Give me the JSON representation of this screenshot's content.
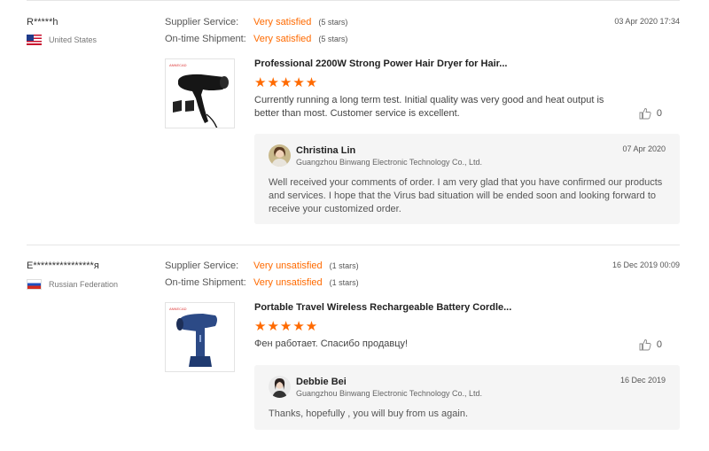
{
  "reviews": [
    {
      "buyer": "R*****h",
      "country": "United States",
      "supplier_service_label": "Supplier Service:",
      "supplier_service_value": "Very satisfied",
      "supplier_service_stars": "(5 stars)",
      "shipment_label": "On-time Shipment:",
      "shipment_value": "Very satisfied",
      "shipment_stars": "(5 stars)",
      "date": "03 Apr 2020 17:34",
      "product_brand": "ANNECAD",
      "product_title": "Professional 2200W Strong Power Hair Dryer for Hair...",
      "stars": "★★★★★",
      "rating": 5,
      "text": "Currently running a long term test. Initial quality was very good and heat output is better than most. Customer service is excellent.",
      "helpful_count": "0",
      "reply": {
        "name": "Christina Lin",
        "company": "Guangzhou Binwang Electronic Technology Co., Ltd.",
        "date": "07 Apr 2020",
        "text": "Well received your comments of order. I am very glad that you have confirmed our products and services. I hope that the Virus  bad situation will be ended soon  and  looking forward to receive your customized order."
      }
    },
    {
      "buyer": "E****************я",
      "country": "Russian Federation",
      "supplier_service_label": "Supplier Service:",
      "supplier_service_value": "Very unsatisfied",
      "supplier_service_stars": "(1 stars)",
      "shipment_label": "On-time Shipment:",
      "shipment_value": "Very unsatisfied",
      "shipment_stars": "(1 stars)",
      "date": "16 Dec 2019 00:09",
      "product_brand": "ANNECAD",
      "product_title": "Portable Travel Wireless Rechargeable Battery Cordle...",
      "stars": "★★★★★",
      "rating": 5,
      "text": "Фен работает. Спасибо продавцу!",
      "helpful_count": "0",
      "reply": {
        "name": "Debbie Bei",
        "company": "Guangzhou Binwang Electronic Technology Co., Ltd.",
        "date": "16 Dec 2019",
        "text": "Thanks, hopefully , you will buy from us again."
      }
    }
  ],
  "colors": {
    "accent": "#ff6a00",
    "reply_bg": "#f5f5f5"
  }
}
